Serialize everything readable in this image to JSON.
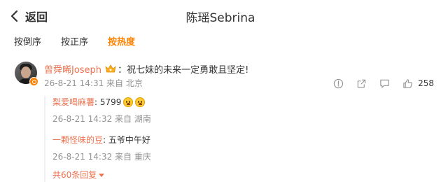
{
  "header": {
    "back_label": "返回",
    "title": "陈瑶Sebrina"
  },
  "sort_tabs": [
    {
      "label": "按倒序",
      "active": false
    },
    {
      "label": "按正序",
      "active": false
    },
    {
      "label": "按热度",
      "active": true
    }
  ],
  "comment": {
    "username": "曾舜晞Joseph",
    "text": "：祝七妹的未来一定勇敢且坚定!",
    "meta": "26-8-21 14:31 来自 北京",
    "like_count": "258",
    "replies": [
      {
        "name": "梨爱喝麻薯",
        "text": ": 5799",
        "meta": "26-8-21 14:32 来自 湖南"
      },
      {
        "name": "一颗怪味的豆",
        "text": ": 五爷中午好",
        "meta": "26-8-21 14:32 来自 重庆"
      }
    ],
    "more_replies": "共60条回复"
  },
  "icons": {
    "back": "chevron-left-icon",
    "crown": "crown-icon",
    "report": "report-icon",
    "share": "share-icon",
    "comment": "comment-icon",
    "like": "thumbs-up-icon"
  },
  "colors": {
    "accent": "#ff8200",
    "username": "#eb7350",
    "meta": "#939393"
  }
}
